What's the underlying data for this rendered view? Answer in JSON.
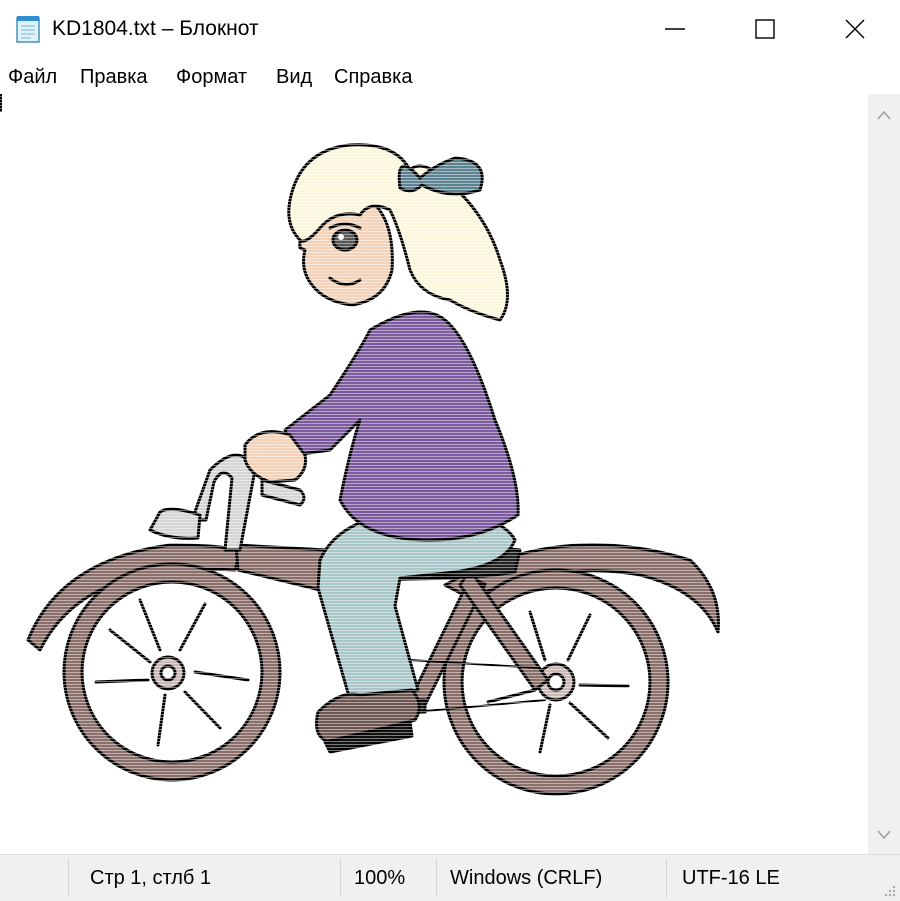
{
  "window": {
    "title": "KD1804.txt – Блокнот",
    "icon": "notepad-icon",
    "controls": [
      "minimize-icon",
      "maximize-icon",
      "close-icon"
    ]
  },
  "menu": {
    "items": [
      "Файл",
      "Правка",
      "Формат",
      "Вид",
      "Справка"
    ]
  },
  "editor": {
    "content": "girl-riding-bicycle-illustration"
  },
  "status": {
    "position": "Стр 1, стлб 1",
    "zoom": "100%",
    "line_ending": "Windows (CRLF)",
    "encoding": "UTF-16 LE"
  },
  "colors": {
    "sweater": "#7b5b9e",
    "jeans": "#a9c6c8",
    "bike": "#8a6f6a",
    "hair": "#fbf7dc",
    "bow": "#5d8391",
    "shoe": "#6e5650",
    "skin": "#f2d2b8"
  }
}
